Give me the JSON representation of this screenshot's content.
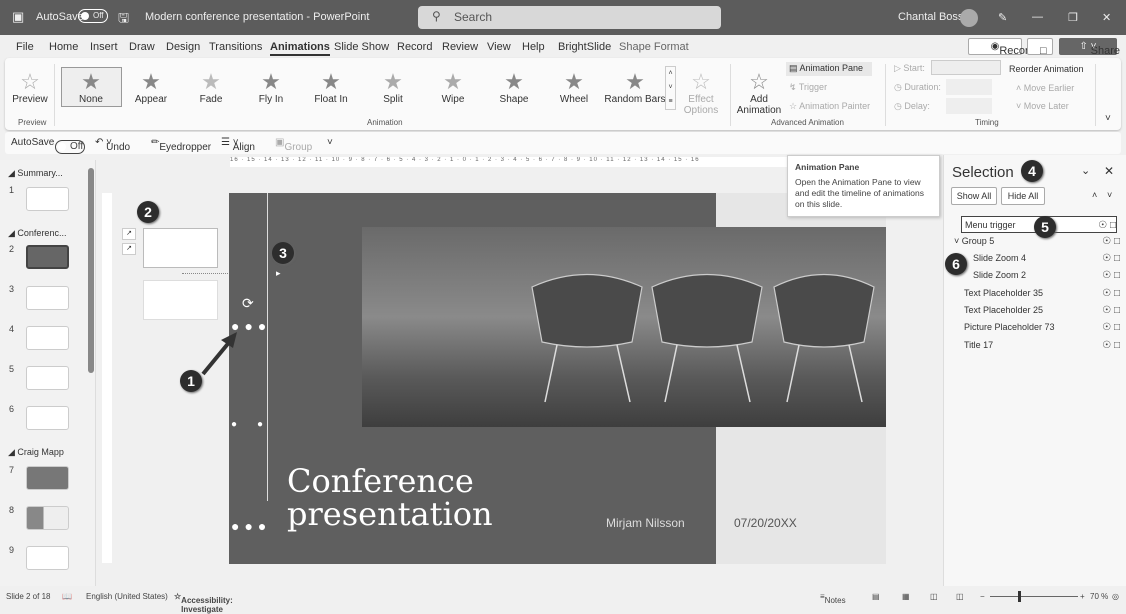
{
  "titlebar": {
    "app_icon": "powerpoint-icon",
    "autosave": "AutoSave",
    "autosave_state": "Off",
    "doc_title": "Modern conference presentation  -  PowerPoint",
    "search_placeholder": "Search",
    "user": "Chantal Bossé"
  },
  "tabs": [
    "File",
    "Home",
    "Insert",
    "Draw",
    "Design",
    "Transitions",
    "Animations",
    "Slide Show",
    "Record",
    "Review",
    "View",
    "Help",
    "BrightSlide",
    "Shape Format"
  ],
  "active_tab": "Animations",
  "right_buttons": {
    "record": "Record",
    "share": "Share"
  },
  "ribbon": {
    "preview": "Preview",
    "preview_group": "Preview",
    "animations": [
      "None",
      "Appear",
      "Fade",
      "Fly In",
      "Float In",
      "Split",
      "Wipe",
      "Shape",
      "Wheel",
      "Random Bars"
    ],
    "effect_options": "Effect Options",
    "animation_group": "Animation",
    "add_animation": "Add Animation",
    "animation_pane": "Animation Pane",
    "trigger": "Trigger",
    "animation_painter": "Animation Painter",
    "advanced_group": "Advanced Animation",
    "start": "Start:",
    "duration": "Duration:",
    "delay": "Delay:",
    "timing_group": "Timing",
    "reorder": "Reorder Animation",
    "move_earlier": "Move Earlier",
    "move_later": "Move Later"
  },
  "qat": {
    "autosave": "AutoSave",
    "autosave_state": "Off",
    "undo": "Undo",
    "eyedropper": "Eyedropper",
    "align": "Align",
    "group": "Group"
  },
  "thumbnails": {
    "sections": [
      "Summary...",
      "Conferenc...",
      "Craig Mapp"
    ],
    "slides": [
      "1",
      "2",
      "3",
      "4",
      "5",
      "6",
      "7",
      "8",
      "9"
    ],
    "selected": "2"
  },
  "ruler_labels": "16 · 15 · 14 · 13 · 12 · 11 · 10 · 9 · 8 · 7 · 6 · 5 · 4 · 3 · 2 · 1 · 0 · 1 · 2 · 3 · 4 · 5 · 6 · 7 · 8 · 9 · 10 · 11 · 12 · 13 · 14 · 15 · 16",
  "slide": {
    "title_line1": "Conference",
    "title_line2": "presentation",
    "presenter": "Mirjam Nilsson",
    "date": "07/20/20XX"
  },
  "callouts": [
    "1",
    "2",
    "3",
    "4",
    "5",
    "6"
  ],
  "tooltip": {
    "title": "Animation Pane",
    "body": "Open the Animation Pane to view and edit the timeline of animations on this slide."
  },
  "selection_pane": {
    "title": "Selection",
    "show_all": "Show All",
    "hide_all": "Hide All",
    "items": [
      {
        "name": "Menu trigger",
        "indent": 0,
        "selected": true
      },
      {
        "name": "Group 5",
        "indent": 0,
        "group": true
      },
      {
        "name": "Slide Zoom 4",
        "indent": 1
      },
      {
        "name": "Slide Zoom 2",
        "indent": 1
      },
      {
        "name": "Text Placeholder 35",
        "indent": 0
      },
      {
        "name": "Text Placeholder 25",
        "indent": 0
      },
      {
        "name": "Picture Placeholder 73",
        "indent": 0
      },
      {
        "name": "Title 17",
        "indent": 0
      }
    ]
  },
  "status": {
    "slide": "Slide 2 of 18",
    "language": "English (United States)",
    "accessibility": "Accessibility: Investigate",
    "notes": "Notes",
    "zoom": "70 %",
    "zoom_percent": 70
  }
}
